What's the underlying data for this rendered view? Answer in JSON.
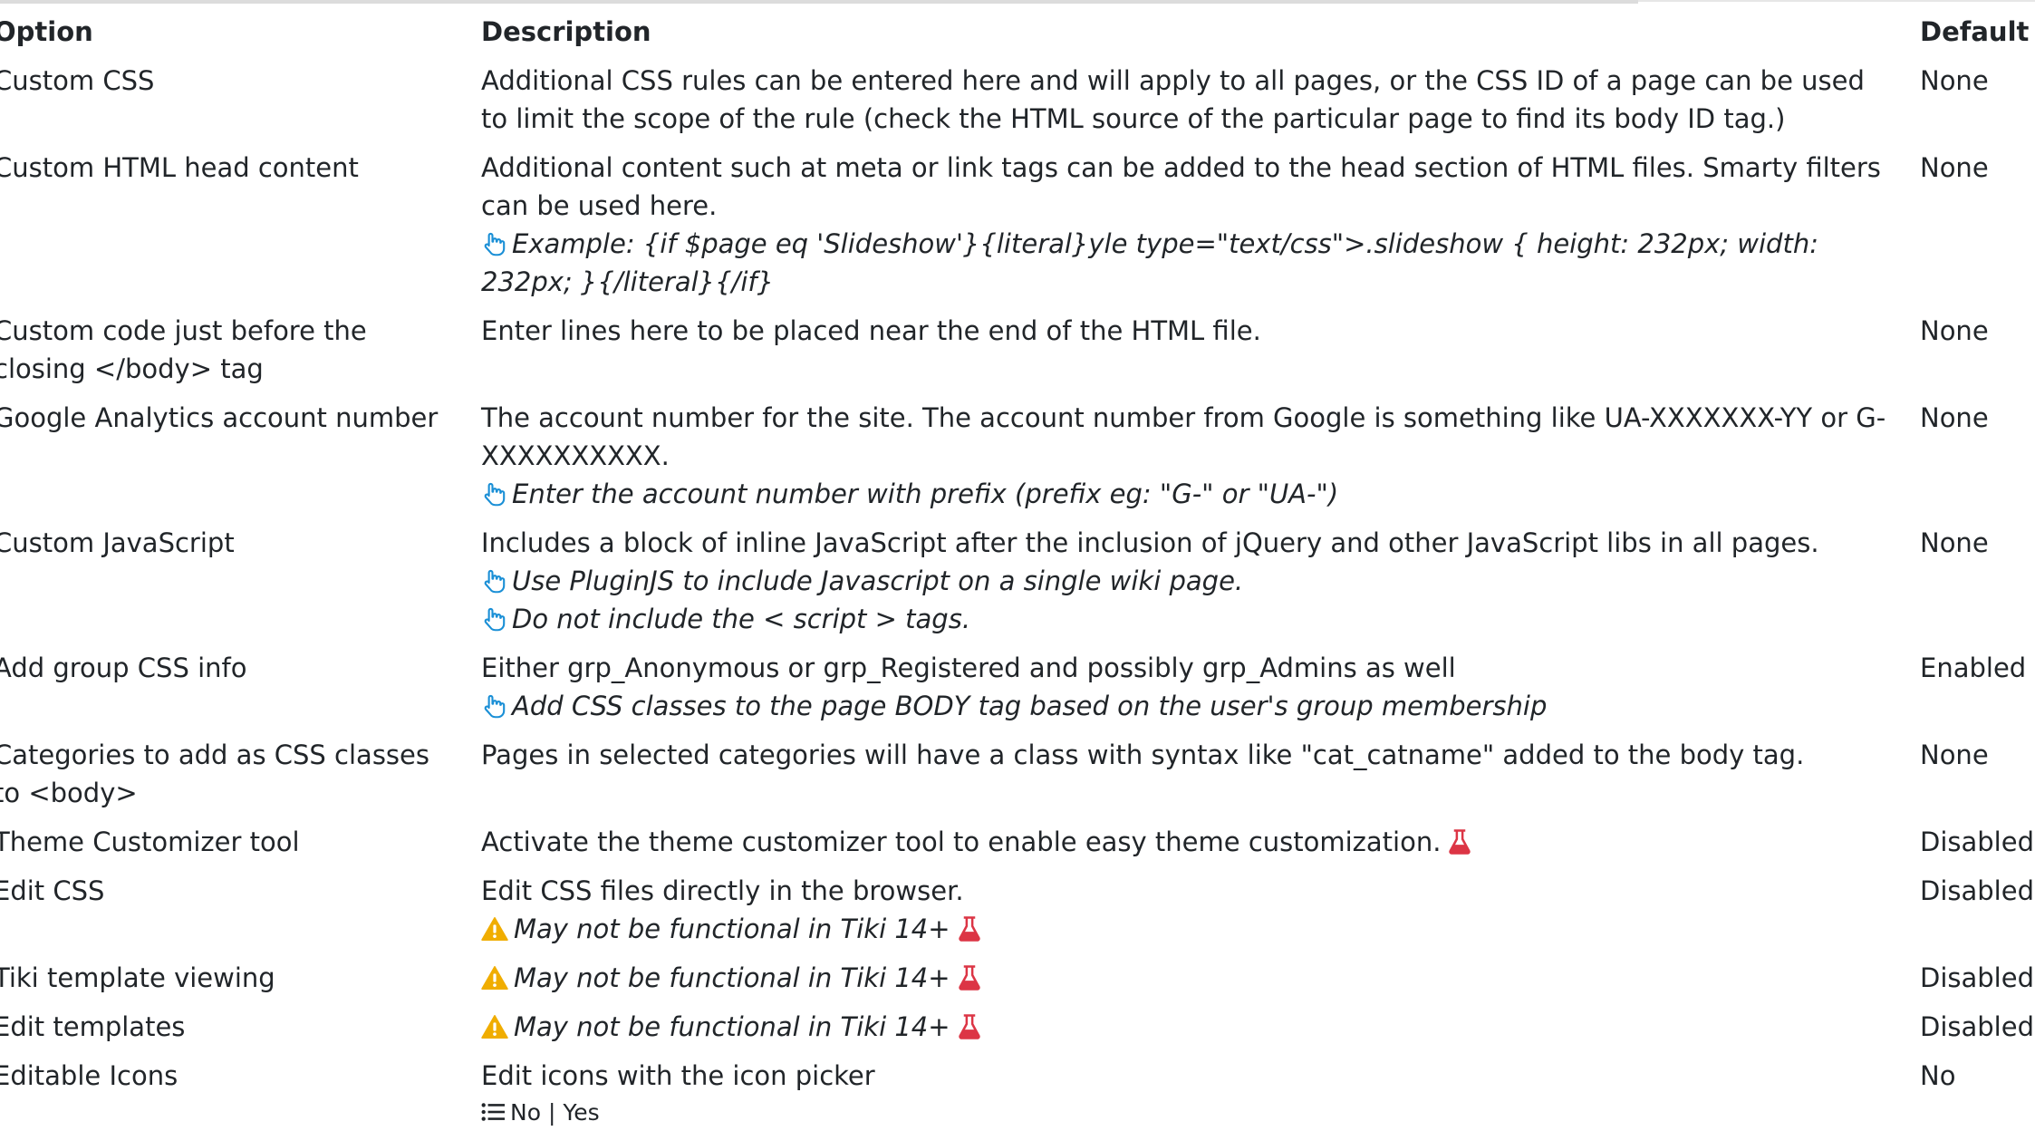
{
  "table": {
    "headers": {
      "option": "Option",
      "description": "Description",
      "default": "Default"
    },
    "rows": [
      {
        "option": "Custom CSS",
        "description": "Additional CSS rules can be entered here and will apply to all pages, or the CSS ID of a page can be used to limit the scope of the rule (check the HTML source of the particular page to find its body ID tag.)",
        "default": "None"
      },
      {
        "option": "Custom HTML head content",
        "description": "Additional content such at meta or link tags can be added to the head section of HTML files. Smarty filters can be used here.",
        "hint": "Example: {if $page eq 'Slideshow'}{literal}yle type=\"text/css\">.slideshow { height: 232px; width: 232px; }{/literal}{/if}",
        "default": "None"
      },
      {
        "option": "Custom code just before the closing </body> tag",
        "description": "Enter lines here to be placed near the end of the HTML file.",
        "default": "None"
      },
      {
        "option": "Google Analytics account number",
        "description": "The account number for the site. The account number from Google is something like UA-XXXXXXX-YY or G-XXXXXXXXXX.",
        "hint": "Enter the account number with prefix (prefix eg: \"G-\" or \"UA-\")",
        "default": "None"
      },
      {
        "option": "Custom JavaScript",
        "description": "Includes a block of inline JavaScript after the inclusion of jQuery and other JavaScript libs in all pages.",
        "hint1": "Use PluginJS to include Javascript on a single wiki page.",
        "hint2": "Do not include the < script > tags.",
        "default": "None"
      },
      {
        "option": "Add group CSS info",
        "description": "Either grp_Anonymous or grp_Registered and possibly grp_Admins as well",
        "hint": "Add CSS classes to the page BODY tag based on the user's group membership",
        "default": "Enabled"
      },
      {
        "option": "Categories to add as CSS classes to <body>",
        "description": "Pages in selected categories will have a class with syntax like \"cat_catname\" added to the body tag.",
        "default": "None"
      },
      {
        "option": "Theme Customizer tool",
        "description": "Activate the theme customizer tool to enable easy theme customization.",
        "default": "Disabled"
      },
      {
        "option": "Edit CSS",
        "description": "Edit CSS files directly in the browser.",
        "warning": "May not be functional in Tiki 14+",
        "default": "Disabled"
      },
      {
        "option": "Tiki template viewing",
        "warning": "May not be functional in Tiki 14+",
        "default": "Disabled"
      },
      {
        "option": "Edit templates",
        "warning": "May not be functional in Tiki 14+",
        "default": "Disabled"
      },
      {
        "option": "Editable Icons",
        "description": "Edit icons with the icon picker",
        "choices": "No | Yes",
        "default": "No"
      }
    ]
  },
  "icons": {
    "hint": "hand-pointer-icon",
    "warning": "warning-triangle-icon",
    "experimental": "flask-icon",
    "list": "list-icon"
  },
  "colors": {
    "hint_icon": "#1a8fd6",
    "warning_icon": "#f0ad00",
    "experimental_icon": "#dc3545",
    "text": "#212529"
  }
}
